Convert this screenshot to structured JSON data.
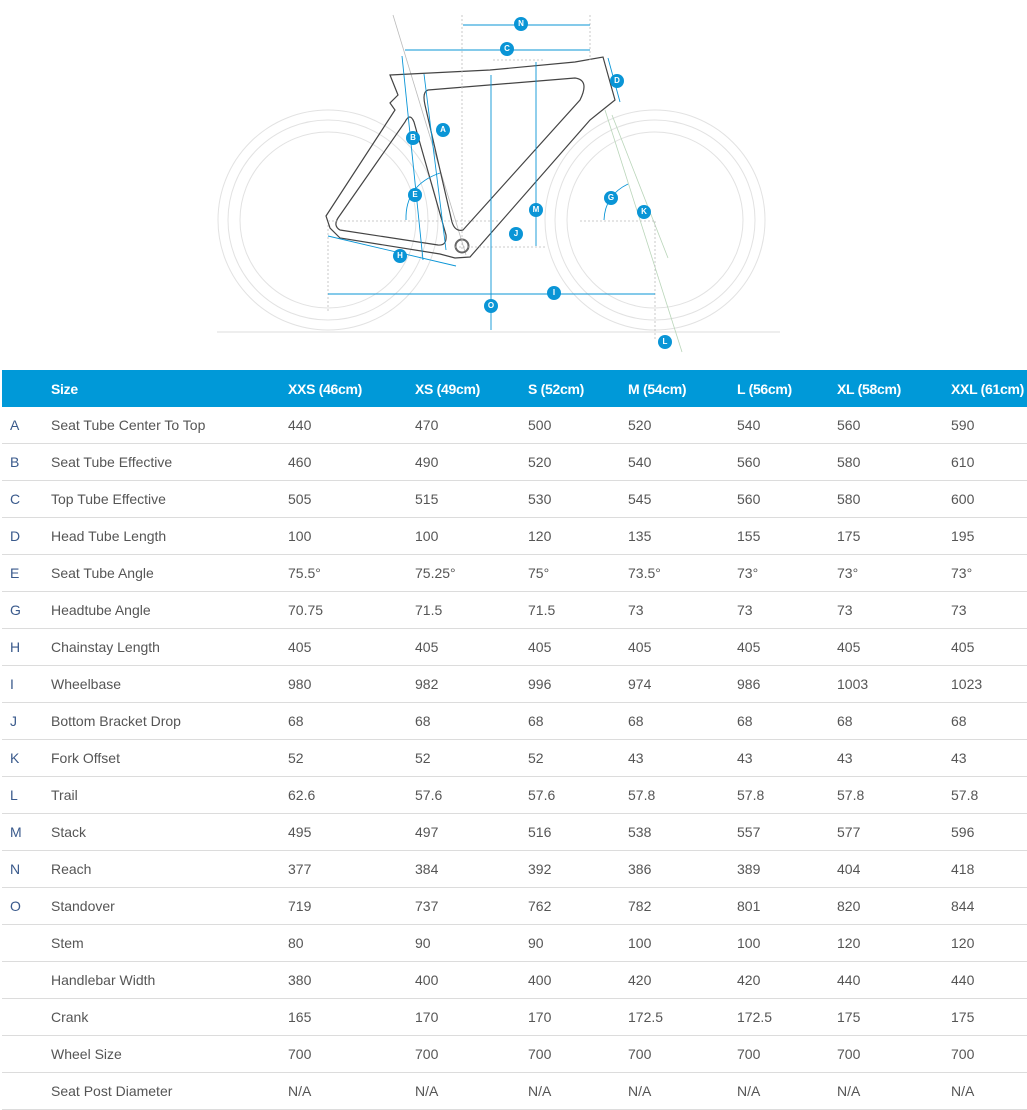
{
  "diagram": {
    "title": "Frame geometry diagram",
    "accent_color": "#0a95d6",
    "badges": [
      "N",
      "C",
      "D",
      "A",
      "B",
      "E",
      "M",
      "J",
      "H",
      "G",
      "K",
      "I",
      "O",
      "L"
    ]
  },
  "table": {
    "header_color": "#0099d8",
    "columns": [
      "",
      "Size",
      "XXS (46cm)",
      "XS (49cm)",
      "S (52cm)",
      "M (54cm)",
      "L (56cm)",
      "XL (58cm)",
      "XXL (61cm)"
    ],
    "rows": [
      {
        "letter": "A",
        "label": "Seat Tube Center To Top",
        "values": [
          "440",
          "470",
          "500",
          "520",
          "540",
          "560",
          "590"
        ]
      },
      {
        "letter": "B",
        "label": "Seat Tube Effective",
        "values": [
          "460",
          "490",
          "520",
          "540",
          "560",
          "580",
          "610"
        ]
      },
      {
        "letter": "C",
        "label": "Top Tube Effective",
        "values": [
          "505",
          "515",
          "530",
          "545",
          "560",
          "580",
          "600"
        ]
      },
      {
        "letter": "D",
        "label": "Head Tube Length",
        "values": [
          "100",
          "100",
          "120",
          "135",
          "155",
          "175",
          "195"
        ]
      },
      {
        "letter": "E",
        "label": "Seat Tube Angle",
        "values": [
          "75.5°",
          "75.25°",
          "75°",
          "73.5°",
          "73°",
          "73°",
          "73°"
        ]
      },
      {
        "letter": "G",
        "label": "Headtube Angle",
        "values": [
          "70.75",
          "71.5",
          "71.5",
          "73",
          "73",
          "73",
          "73"
        ]
      },
      {
        "letter": "H",
        "label": "Chainstay Length",
        "values": [
          "405",
          "405",
          "405",
          "405",
          "405",
          "405",
          "405"
        ]
      },
      {
        "letter": "I",
        "label": "Wheelbase",
        "values": [
          "980",
          "982",
          "996",
          "974",
          "986",
          "1003",
          "1023"
        ]
      },
      {
        "letter": "J",
        "label": "Bottom Bracket Drop",
        "values": [
          "68",
          "68",
          "68",
          "68",
          "68",
          "68",
          "68"
        ]
      },
      {
        "letter": "K",
        "label": "Fork Offset",
        "values": [
          "52",
          "52",
          "52",
          "43",
          "43",
          "43",
          "43"
        ]
      },
      {
        "letter": "L",
        "label": "Trail",
        "values": [
          "62.6",
          "57.6",
          "57.6",
          "57.8",
          "57.8",
          "57.8",
          "57.8"
        ]
      },
      {
        "letter": "M",
        "label": "Stack",
        "values": [
          "495",
          "497",
          "516",
          "538",
          "557",
          "577",
          "596"
        ]
      },
      {
        "letter": "N",
        "label": "Reach",
        "values": [
          "377",
          "384",
          "392",
          "386",
          "389",
          "404",
          "418"
        ]
      },
      {
        "letter": "O",
        "label": "Standover",
        "values": [
          "719",
          "737",
          "762",
          "782",
          "801",
          "820",
          "844"
        ]
      },
      {
        "letter": "",
        "label": "Stem",
        "values": [
          "80",
          "90",
          "90",
          "100",
          "100",
          "120",
          "120"
        ]
      },
      {
        "letter": "",
        "label": "Handlebar Width",
        "values": [
          "380",
          "400",
          "400",
          "420",
          "420",
          "440",
          "440"
        ]
      },
      {
        "letter": "",
        "label": "Crank",
        "values": [
          "165",
          "170",
          "170",
          "172.5",
          "172.5",
          "175",
          "175"
        ]
      },
      {
        "letter": "",
        "label": "Wheel Size",
        "values": [
          "700",
          "700",
          "700",
          "700",
          "700",
          "700",
          "700"
        ]
      },
      {
        "letter": "",
        "label": "Seat Post Diameter",
        "values": [
          "N/A",
          "N/A",
          "N/A",
          "N/A",
          "N/A",
          "N/A",
          "N/A"
        ]
      }
    ]
  }
}
